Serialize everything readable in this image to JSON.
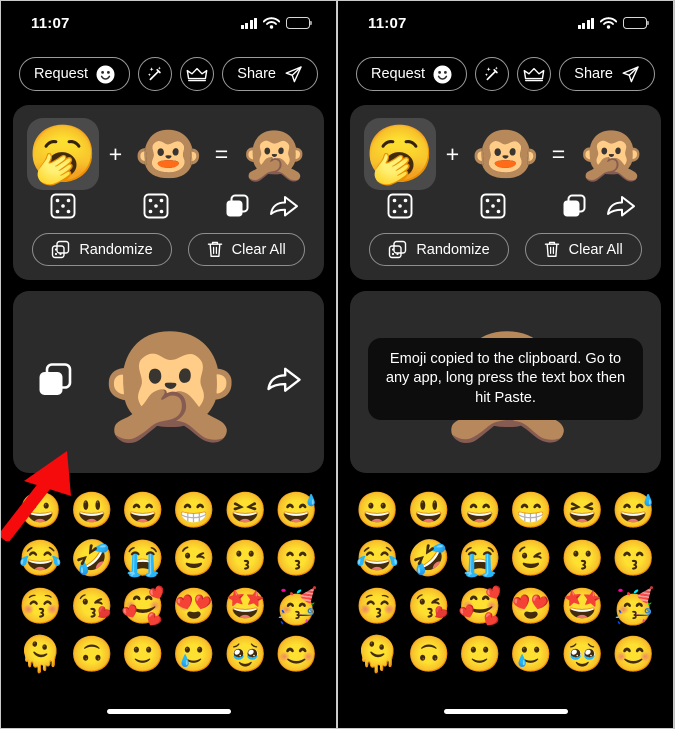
{
  "status": {
    "time": "11:07",
    "signal_icon": "cellular-signal-icon",
    "wifi_icon": "wifi-icon",
    "battery_icon": "battery-low-icon"
  },
  "toolbar": {
    "request_label": "Request",
    "request_icon": "smiley-face-icon",
    "magic_icon": "magic-wand-icon",
    "crown_icon": "crown-icon",
    "share_label": "Share",
    "share_icon": "paper-plane-icon"
  },
  "mixer": {
    "first_emoji": "🥱",
    "second_emoji": "🐵",
    "result_emoji": "🙊",
    "plus_symbol": "+",
    "equals_symbol": "=",
    "dice_icon": "dice-icon",
    "copy_icon": "copy-icon",
    "share_arrow_icon": "share-arrow-icon",
    "randomize_label": "Randomize",
    "randomize_icon": "dice-stack-icon",
    "clear_label": "Clear All",
    "clear_icon": "trash-icon"
  },
  "result": {
    "emoji": "🙊",
    "copy_icon": "copy-icon",
    "share_icon": "share-arrow-icon"
  },
  "toast": {
    "message": "Emoji copied to the clipboard. Go to any app, long press the text box then hit Paste."
  },
  "emoji_grid": {
    "rows": [
      [
        "😀",
        "😃",
        "😄",
        "😁",
        "😆",
        "😅"
      ],
      [
        "😂",
        "🤣",
        "😭",
        "😉",
        "😗",
        "😙"
      ],
      [
        "😚",
        "😘",
        "🥰",
        "😍",
        "🤩",
        "🥳"
      ],
      [
        "🫠",
        "🙃",
        "🙂",
        "🥲",
        "🥹",
        "😊"
      ]
    ]
  },
  "annotation": {
    "arrow_color": "#f50b0b",
    "arrow_target": "copy-icon"
  },
  "colors": {
    "screen_background": "#000000",
    "card_background": "#2b2b2b",
    "selected_slot": "#4a4a4a",
    "toast_background": "#0d0d0d",
    "outline": "#9b9b9b",
    "text": "#ffffff",
    "battery_red": "#e8332a"
  }
}
